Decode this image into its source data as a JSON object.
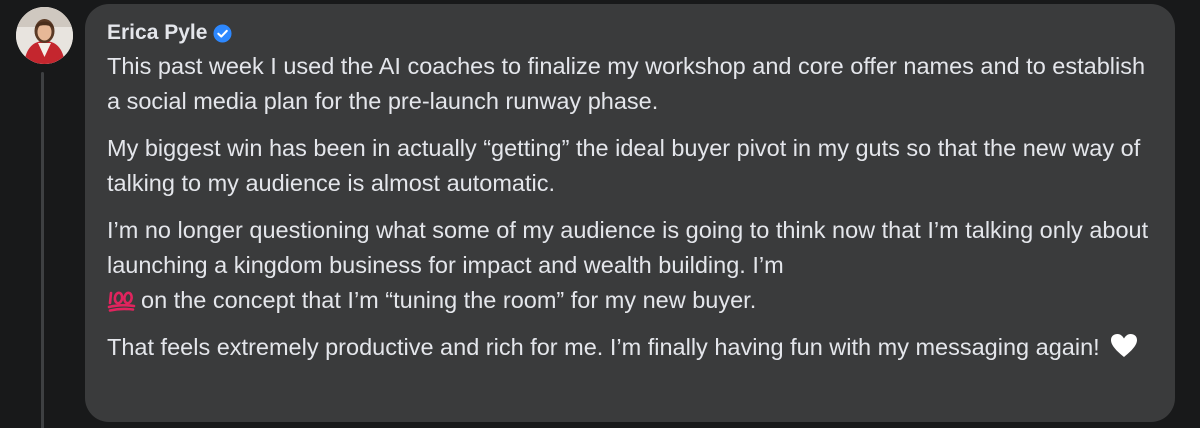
{
  "comment": {
    "author": "Erica Pyle",
    "verified": true,
    "paragraphs": [
      "This past week I used the AI coaches to finalize my workshop and core offer names and to establish a social media plan for the pre-launch runway phase.",
      "My biggest win has been in actually “getting” the ideal buyer pivot in my guts so that the new way of talking to my audience is almost automatic.",
      "I’m no longer questioning what some of my audience is going to think now that I’m talking only about launching a kingdom business for impact and wealth building. I’m",
      "That feels extremely productive and rich for me. I’m finally having fun with my messaging again!"
    ],
    "paragraph3_tail": "on the concept that I’m “tuning the room” for my new buyer.",
    "colors": {
      "page_bg": "#18191a",
      "bubble_bg": "#3a3b3c",
      "text": "#e4e6eb",
      "verified_badge": "#2d88ff",
      "emoji_100": "#e0245e"
    },
    "icons": [
      "verified-badge-icon",
      "hundred-points-emoji-icon",
      "white-heart-emoji-icon"
    ]
  }
}
